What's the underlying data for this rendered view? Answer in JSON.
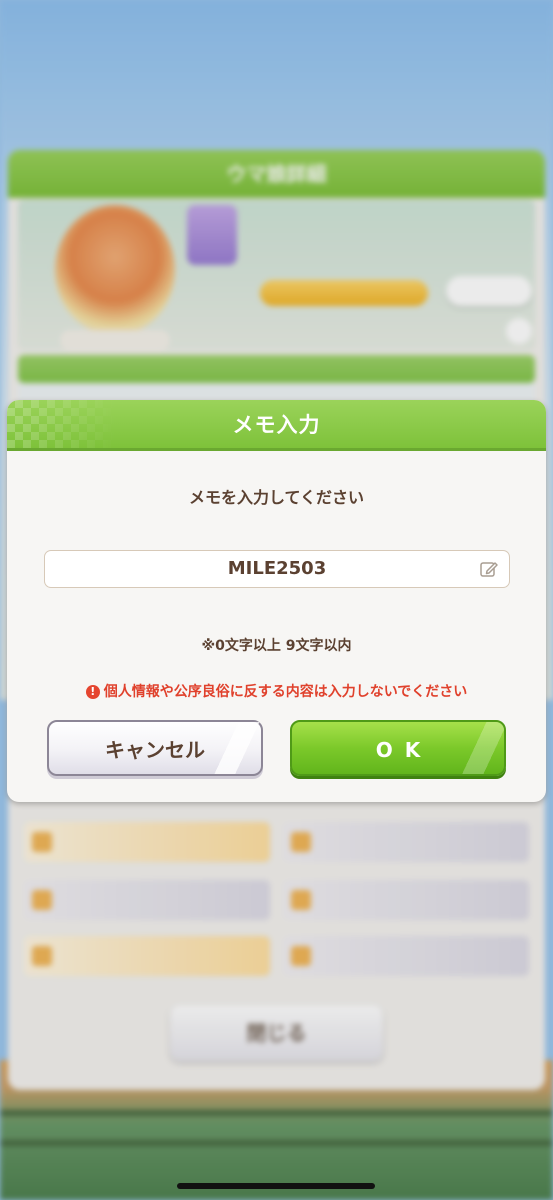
{
  "background": {
    "screen_title": "ウマ娘詳細",
    "close_label": "閉じる"
  },
  "dialog": {
    "title": "メモ入力",
    "prompt": "メモを入力してください",
    "memo_value": "MILE2503",
    "limit_note": "※0文字以上 9文字以内",
    "warning_icon": "!",
    "warning": "個人情報や公序良俗に反する内容は入力しないでください",
    "cancel_label": "キャンセル",
    "ok_label": "OK"
  },
  "colors": {
    "header_green": "#7ec23a",
    "text_brown": "#5b4131",
    "warning_red": "#e0412c",
    "ok_green": "#7cc92a"
  }
}
